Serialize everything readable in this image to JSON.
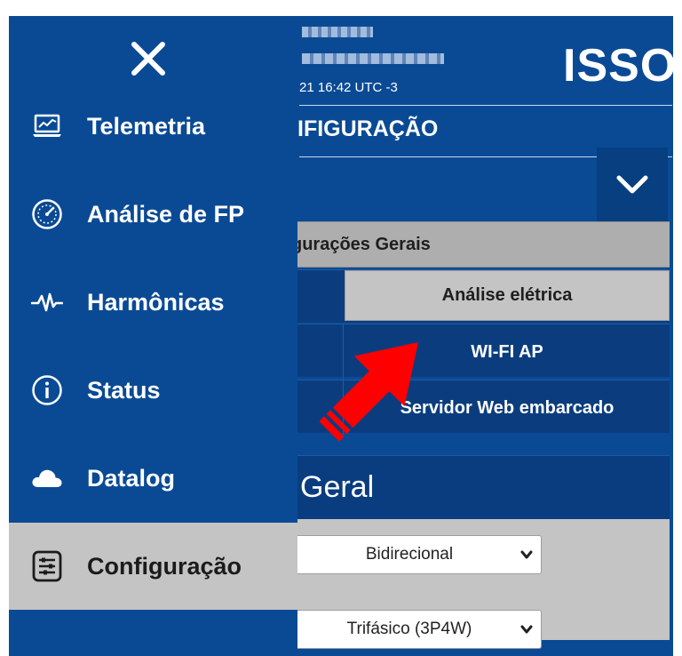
{
  "header": {
    "timestamp": "21 16:42 UTC -3",
    "brand": "ISSO",
    "section_title": "IFIGURAÇÃO"
  },
  "submenu": {
    "header": "gurações Gerais",
    "items": [
      {
        "label": "Análise elétrica",
        "selected": true
      },
      {
        "label": "WI-FI AP",
        "selected": false
      },
      {
        "label": "Servidor Web embarcado",
        "selected": false
      }
    ]
  },
  "panel": {
    "title": "Geral",
    "selects": [
      {
        "value": "Bidirecional"
      },
      {
        "value": "Trifásico (3P4W)"
      }
    ]
  },
  "drawer": {
    "items": [
      {
        "label": "Telemetria",
        "icon": "laptop-chart-icon"
      },
      {
        "label": "Análise de FP",
        "icon": "gauge-icon"
      },
      {
        "label": "Harmônicas",
        "icon": "waveform-icon"
      },
      {
        "label": "Status",
        "icon": "info-icon"
      },
      {
        "label": "Datalog",
        "icon": "cloud-icon"
      },
      {
        "label": "Configuração",
        "icon": "settings-list-icon",
        "active": true
      }
    ]
  },
  "colors": {
    "primary": "#0a4a95",
    "dark_primary": "#0b3d7e",
    "highlight_gray": "#c4c4c4",
    "annotation_red": "#ff0000"
  }
}
